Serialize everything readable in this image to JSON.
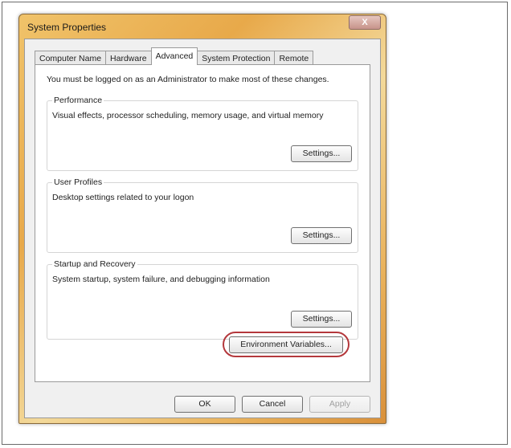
{
  "window": {
    "title": "System Properties",
    "close_label": "X"
  },
  "tabs": [
    {
      "label": "Computer Name",
      "active": false
    },
    {
      "label": "Hardware",
      "active": false
    },
    {
      "label": "Advanced",
      "active": true
    },
    {
      "label": "System Protection",
      "active": false
    },
    {
      "label": "Remote",
      "active": false
    }
  ],
  "notice": "You must be logged on as an Administrator to make most of these changes.",
  "groups": {
    "performance": {
      "title": "Performance",
      "description": "Visual effects, processor scheduling, memory usage, and virtual memory",
      "button": "Settings..."
    },
    "user_profiles": {
      "title": "User Profiles",
      "description": "Desktop settings related to your logon",
      "button": "Settings..."
    },
    "startup_recovery": {
      "title": "Startup and Recovery",
      "description": "System startup, system failure, and debugging information",
      "button": "Settings..."
    }
  },
  "env_button": "Environment Variables...",
  "footer": {
    "ok": "OK",
    "cancel": "Cancel",
    "apply": "Apply"
  },
  "colors": {
    "highlight": "#b4383c",
    "title_gradient_accent": "#e8a94a"
  }
}
